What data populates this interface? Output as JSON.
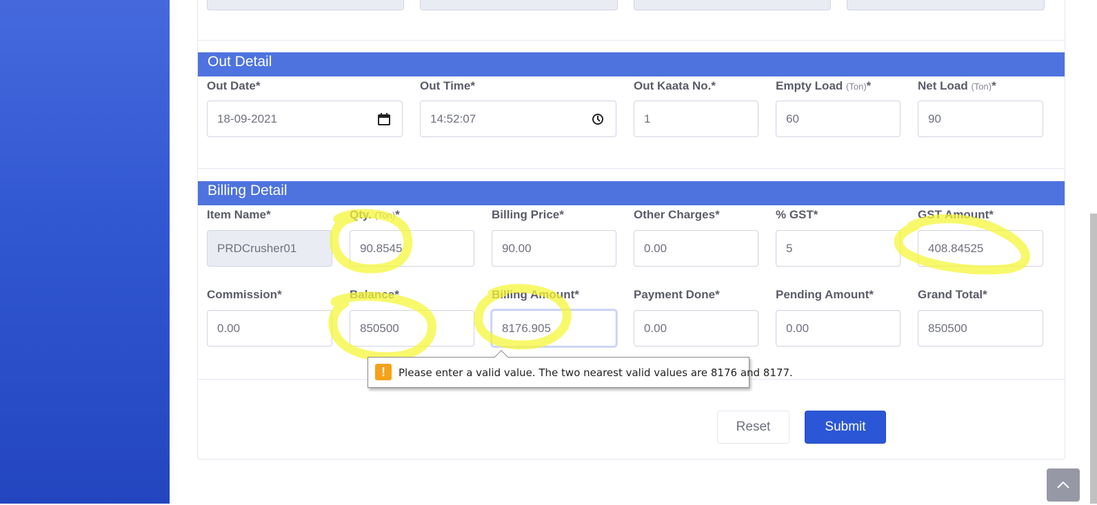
{
  "out_detail": {
    "title": "Out Detail",
    "out_date": {
      "label": "Out Date*",
      "value": "18-09-2021"
    },
    "out_time": {
      "label": "Out Time*",
      "value": "14:52:07"
    },
    "out_kaata": {
      "label": "Out Kaata No.*",
      "value": "1"
    },
    "empty_load": {
      "label": "Empty Load",
      "unit": "(Ton)",
      "req": "*",
      "value": "60"
    },
    "net_load": {
      "label": "Net Load",
      "unit": "(Ton)",
      "req": "*",
      "value": "90"
    }
  },
  "billing_detail": {
    "title": "Billing Detail",
    "item_name": {
      "label": "Item Name*",
      "value": "PRDCrusher01"
    },
    "qty": {
      "label": "Qty.",
      "unit": "(Ton)",
      "req": "*",
      "value": "90.8545"
    },
    "billing_price": {
      "label": "Billing Price*",
      "value": "90.00"
    },
    "other_charges": {
      "label": "Other Charges*",
      "value": "0.00"
    },
    "gst_percent": {
      "label": "% GST*",
      "value": "5"
    },
    "gst_amount": {
      "label": "GST Amount*",
      "value": "408.84525"
    },
    "commission": {
      "label": "Commission*",
      "value": "0.00"
    },
    "balance": {
      "label": "Balance*",
      "value": "850500"
    },
    "billing_amount": {
      "label": "Billing Amount*",
      "value": "8176.905"
    },
    "payment_done": {
      "label": "Payment Done*",
      "value": "0.00"
    },
    "pending_amount": {
      "label": "Pending Amount*",
      "value": "0.00"
    },
    "grand_total": {
      "label": "Grand Total*",
      "value": "850500"
    }
  },
  "validation_tooltip": {
    "icon": "warning-icon",
    "message": "Please enter a valid value. The two nearest valid values are 8176 and 8177."
  },
  "buttons": {
    "reset": "Reset",
    "submit": "Submit"
  },
  "colors": {
    "sidebar": "#3358d4",
    "section_header": "#4e73df",
    "submit": "#2b57d6",
    "highlight": "#f5f53a",
    "warning": "#f7a11a"
  }
}
